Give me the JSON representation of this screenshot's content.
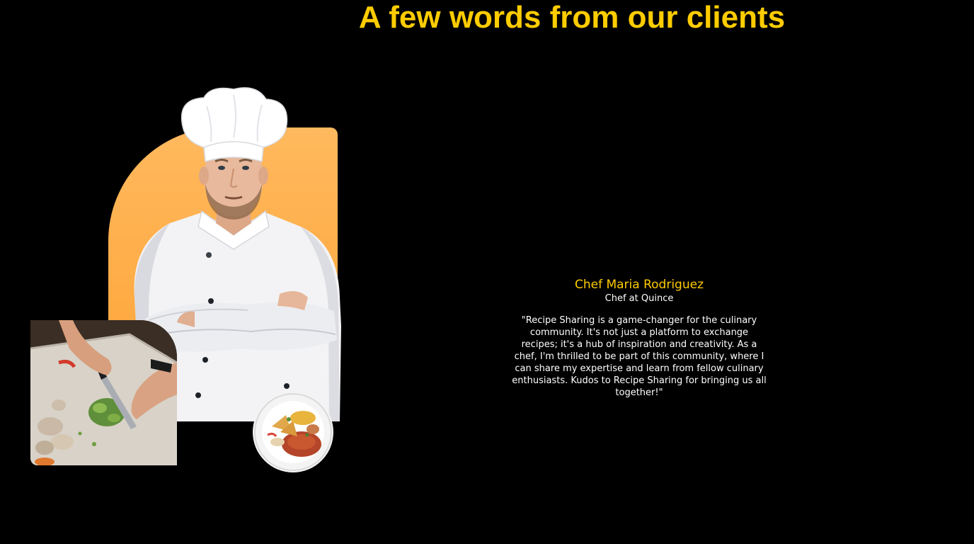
{
  "section": {
    "title": "A few words from our clients"
  },
  "images": {
    "chef": "chef-portrait",
    "cutting": "chopping-vegetables-photo",
    "plate": "food-plate-photo"
  },
  "testimonial": {
    "name": "Chef Maria Rodriguez",
    "role": "Chef at Quince",
    "quote": "\"Recipe Sharing is a game-changer for the culinary community. It's not just a platform to exchange recipes; it's a hub of inspiration and creativity. As a chef, I'm thrilled to be part of this community, where I can share my expertise and learn from fellow culinary enthusiasts. Kudos to Recipe Sharing for bringing us all together!\""
  },
  "colors": {
    "background": "#000000",
    "accent": "#FFCC00",
    "panel": "#FFB04A",
    "text": "#FFFFFF"
  }
}
